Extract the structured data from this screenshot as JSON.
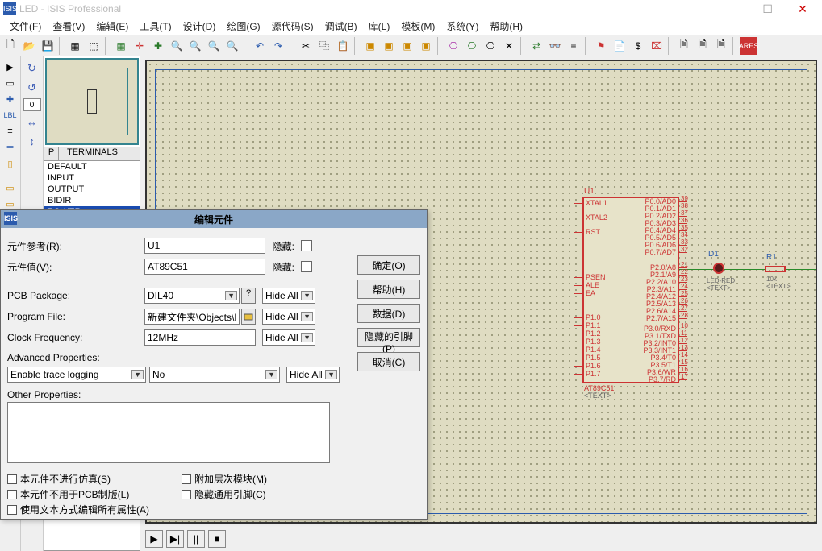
{
  "window": {
    "title": "LED - ISIS Professional"
  },
  "menu": [
    "文件(F)",
    "查看(V)",
    "编辑(E)",
    "工具(T)",
    "设计(D)",
    "绘图(G)",
    "源代码(S)",
    "调试(B)",
    "库(L)",
    "模板(M)",
    "系统(Y)",
    "帮助(H)"
  ],
  "sidebar": {
    "header_p": "P",
    "header_label": "TERMINALS",
    "items": [
      "DEFAULT",
      "INPUT",
      "OUTPUT",
      "BIDIR",
      "POWER"
    ],
    "selected_index": 4
  },
  "spinner_value": "0",
  "dialog": {
    "title": "编辑元件",
    "labels": {
      "ref": "元件参考(R):",
      "val": "元件值(V):",
      "pkg": "PCB Package:",
      "prog": "Program File:",
      "clk": "Clock Frequency:",
      "adv": "Advanced Properties:",
      "other": "Other Properties:",
      "hide": "隐藏:",
      "hideall": "Hide All"
    },
    "fields": {
      "ref": "U1",
      "val": "AT89C51",
      "pkg": "DIL40",
      "prog": "新建文件夹\\Objects\\LED.hex",
      "clk": "12MHz",
      "adv_key": "Enable trace logging",
      "adv_val": "No"
    },
    "buttons": {
      "ok": "确定(O)",
      "help": "帮助(H)",
      "data": "数据(D)",
      "hidden_pins": "隐藏的引脚(P)",
      "cancel": "取消(C)",
      "q": "?"
    },
    "checks": {
      "c1": "本元件不进行仿真(S)",
      "c2": "本元件不用于PCB制版(L)",
      "c3": "使用文本方式编辑所有属性(A)",
      "c4": "附加层次模块(M)",
      "c5": "隐藏通用引脚(C)"
    }
  },
  "schematic": {
    "chip_ref": "U1",
    "chip_footer1": "AT89C51",
    "chip_footer2": "<TEXT>",
    "left_pins_a": [
      "XTAL1",
      "XTAL2",
      "RST"
    ],
    "left_pins_b": [
      "PSEN",
      "ALE",
      "EA"
    ],
    "left_pins_c": [
      "P1.0",
      "P1.1",
      "P1.2",
      "P1.3",
      "P1.4",
      "P1.5",
      "P1.6",
      "P1.7"
    ],
    "right_pins_a": [
      "P0.0/AD0",
      "P0.1/AD1",
      "P0.2/AD2",
      "P0.3/AD3",
      "P0.4/AD4",
      "P0.5/AD5",
      "P0.6/AD6",
      "P0.7/AD7"
    ],
    "right_pins_a_nums": [
      "39",
      "38",
      "37",
      "36",
      "35",
      "34",
      "33",
      "32"
    ],
    "right_pins_b": [
      "P2.0/A8",
      "P2.1/A9",
      "P2.2/A10",
      "P2.3/A11",
      "P2.4/A12",
      "P2.5/A13",
      "P2.6/A14",
      "P2.7/A15"
    ],
    "right_pins_b_nums": [
      "21",
      "22",
      "23",
      "24",
      "25",
      "26",
      "27",
      "28"
    ],
    "right_pins_c": [
      "P3.0/RXD",
      "P3.1/TXD",
      "P3.2/INT0",
      "P3.3/INT1",
      "P3.4/T0",
      "P3.5/T1",
      "P3.6/WR",
      "P3.7/RD"
    ],
    "right_pins_c_nums": [
      "10",
      "11",
      "12",
      "13",
      "14",
      "15",
      "16",
      "17"
    ],
    "led_ref": "D1",
    "led_val": "LED-RED",
    "led_sub": "<TEXT>",
    "res_ref": "R1",
    "res_val": "10k",
    "res_sub": "<TEXT>"
  }
}
